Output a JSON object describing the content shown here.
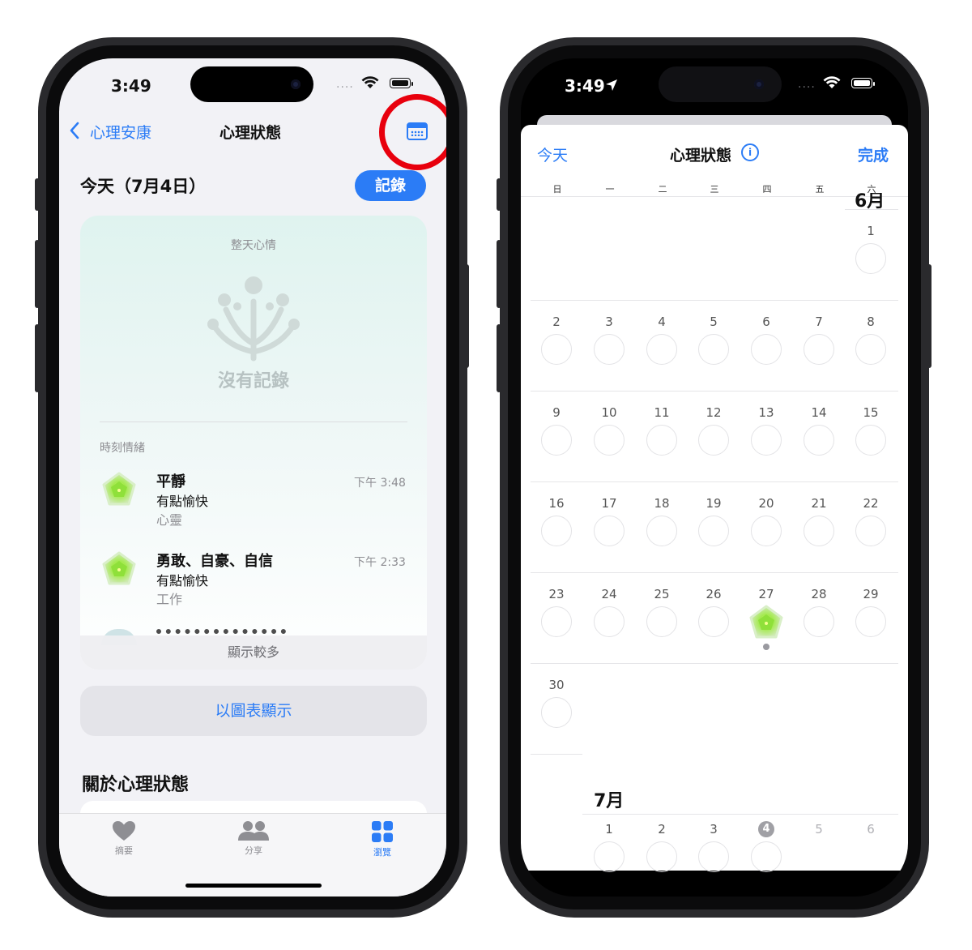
{
  "colors": {
    "accent": "#2b7cf6",
    "highlight_ring": "#e8000d",
    "mood_green": "#8be04f"
  },
  "left": {
    "status": {
      "time": "3:49",
      "signal": "....",
      "wifi_icon": "wifi-icon",
      "battery_icon": "battery-icon"
    },
    "nav": {
      "back_label": "心理安康",
      "title": "心理狀態",
      "calendar_icon": "calendar-icon"
    },
    "today": {
      "title": "今天（7月4日）",
      "log_button": "記錄"
    },
    "card": {
      "heading": "整天心情",
      "empty_text": "沒有記錄",
      "moments_label": "時刻情緒",
      "entries": [
        {
          "title": "平靜",
          "feeling": "有點愉快",
          "tag": "心靈",
          "time": "下午 3:48"
        },
        {
          "title": "勇敢、自豪、自信",
          "feeling": "有點愉快",
          "tag": "工作",
          "time": "下午 2:33"
        }
      ],
      "show_more": "顯示較多"
    },
    "chart_button": "以圖表顯示",
    "about_title": "關於心理狀態",
    "tabs": [
      {
        "label": "摘要",
        "icon": "heart-icon"
      },
      {
        "label": "分享",
        "icon": "people-icon"
      },
      {
        "label": "瀏覽",
        "icon": "grid-icon"
      }
    ]
  },
  "right": {
    "status": {
      "time": "3:49"
    },
    "nav": {
      "today": "今天",
      "title": "心理狀態",
      "done": "完成"
    },
    "weekdays": [
      "日",
      "一",
      "二",
      "三",
      "四",
      "五",
      "六"
    ],
    "june": {
      "label": "6月",
      "weeks": [
        [
          "",
          "",
          "",
          "",
          "",
          "",
          "1"
        ],
        [
          "2",
          "3",
          "4",
          "5",
          "6",
          "7",
          "8"
        ],
        [
          "9",
          "10",
          "11",
          "12",
          "13",
          "14",
          "15"
        ],
        [
          "16",
          "17",
          "18",
          "19",
          "20",
          "21",
          "22"
        ],
        [
          "23",
          "24",
          "25",
          "26",
          "27",
          "28",
          "29"
        ],
        [
          "30",
          "",
          "",
          "",
          "",
          "",
          ""
        ]
      ],
      "logged_day": "27"
    },
    "july": {
      "label": "7月",
      "days": [
        "1",
        "2",
        "3",
        "4",
        "5",
        "6"
      ],
      "today": "4"
    }
  }
}
